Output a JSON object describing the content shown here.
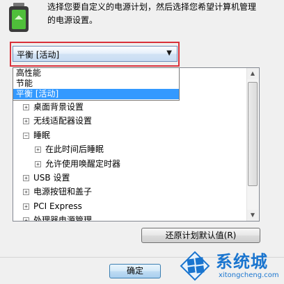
{
  "intro": {
    "line1": "选择您要自定义的电源计划，然后选择您希望计算机管理",
    "line2": "的电源设置。"
  },
  "plan_select": {
    "value": "平衡 [活动]",
    "options": [
      "高性能",
      "节能",
      "平衡 [活动]"
    ],
    "selected_index": 2
  },
  "settings_tree": [
    {
      "label": "桌面背景设置",
      "toggle": "+",
      "level": 0
    },
    {
      "label": "无线适配器设置",
      "toggle": "+",
      "level": 0
    },
    {
      "label": "睡眠",
      "toggle": "−",
      "level": 0
    },
    {
      "label": "在此时间后睡眠",
      "toggle": "+",
      "level": 1
    },
    {
      "label": "允许使用唤醒定时器",
      "toggle": "+",
      "level": 1
    },
    {
      "label": "USB 设置",
      "toggle": "+",
      "level": 0
    },
    {
      "label": "电源按钮和盖子",
      "toggle": "+",
      "level": 0
    },
    {
      "label": "PCI Express",
      "toggle": "+",
      "level": 0
    },
    {
      "label": "处理器电源管理",
      "toggle": "+",
      "level": 0
    }
  ],
  "buttons": {
    "restore": "还原计划默认值(R)",
    "ok": "确定"
  },
  "watermark": {
    "brand": "系统城",
    "url": "xitongcheng.com"
  },
  "colors": {
    "highlight_border": "#d9303a",
    "selection": "#3399ff",
    "watermark": "#1a75cf"
  }
}
